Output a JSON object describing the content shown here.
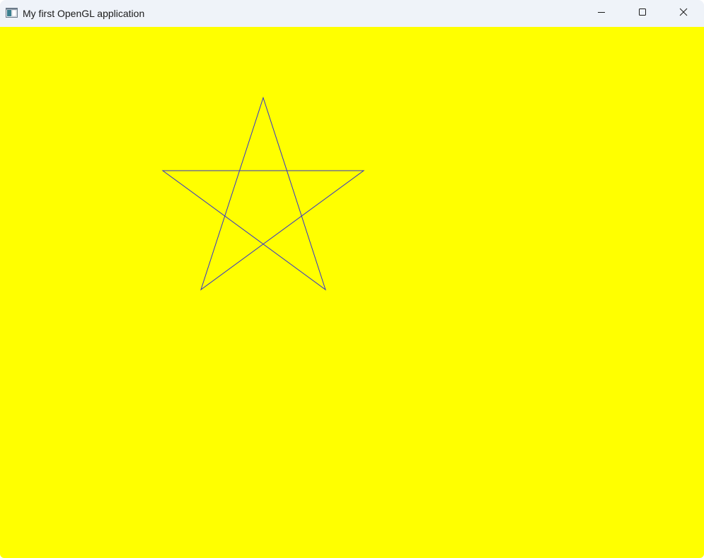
{
  "window": {
    "title": "My first OpenGL application",
    "icon": "app-window-icon",
    "controls": {
      "minimize": "minimize-icon",
      "maximize": "maximize-icon",
      "close": "close-icon"
    }
  },
  "canvas": {
    "background_color": "#ffff00",
    "shape": "pentagram-star",
    "stroke_color": "#3333cc"
  }
}
